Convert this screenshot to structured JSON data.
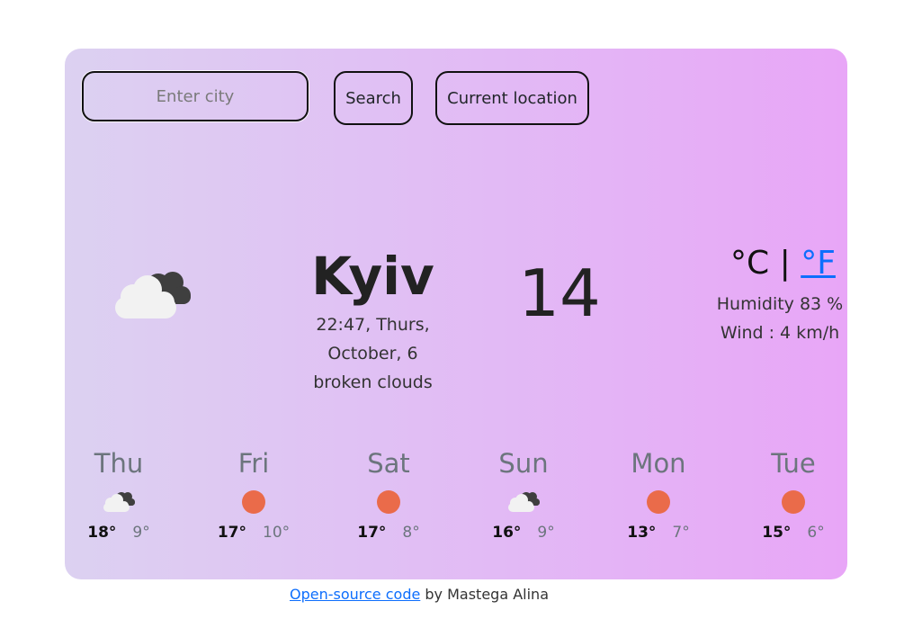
{
  "search": {
    "placeholder": "Enter city",
    "value": ""
  },
  "buttons": {
    "search_label": "Search",
    "location_label": "Current location"
  },
  "current": {
    "icon": "broken-clouds-icon",
    "city": "Kyiv",
    "datetime_line1": "22:47, Thurs,",
    "datetime_line2": "October, 6",
    "description": "broken clouds",
    "temperature": "14",
    "unit_c": "°C",
    "unit_separator": "|",
    "unit_f": "°F",
    "humidity": "Humidity 83 %",
    "wind": "Wind : 4 km/h"
  },
  "forecast": [
    {
      "day": "Thu",
      "icon": "clouds-icon",
      "max": "18°",
      "min": "9°"
    },
    {
      "day": "Fri",
      "icon": "sun-icon",
      "max": "17°",
      "min": "10°"
    },
    {
      "day": "Sat",
      "icon": "sun-icon",
      "max": "17°",
      "min": "8°"
    },
    {
      "day": "Sun",
      "icon": "clouds-icon",
      "max": "16°",
      "min": "9°"
    },
    {
      "day": "Mon",
      "icon": "sun-icon",
      "max": "13°",
      "min": "7°"
    },
    {
      "day": "Tue",
      "icon": "sun-icon",
      "max": "15°",
      "min": "6°"
    }
  ],
  "footer": {
    "link_text": "Open-source code",
    "suffix": " by Mastega Alina"
  },
  "colors": {
    "accent": "#0d6efd",
    "sun": "#ea6b4a",
    "gradient_start": "#dcd1f1",
    "gradient_end": "#e8a6f7"
  }
}
